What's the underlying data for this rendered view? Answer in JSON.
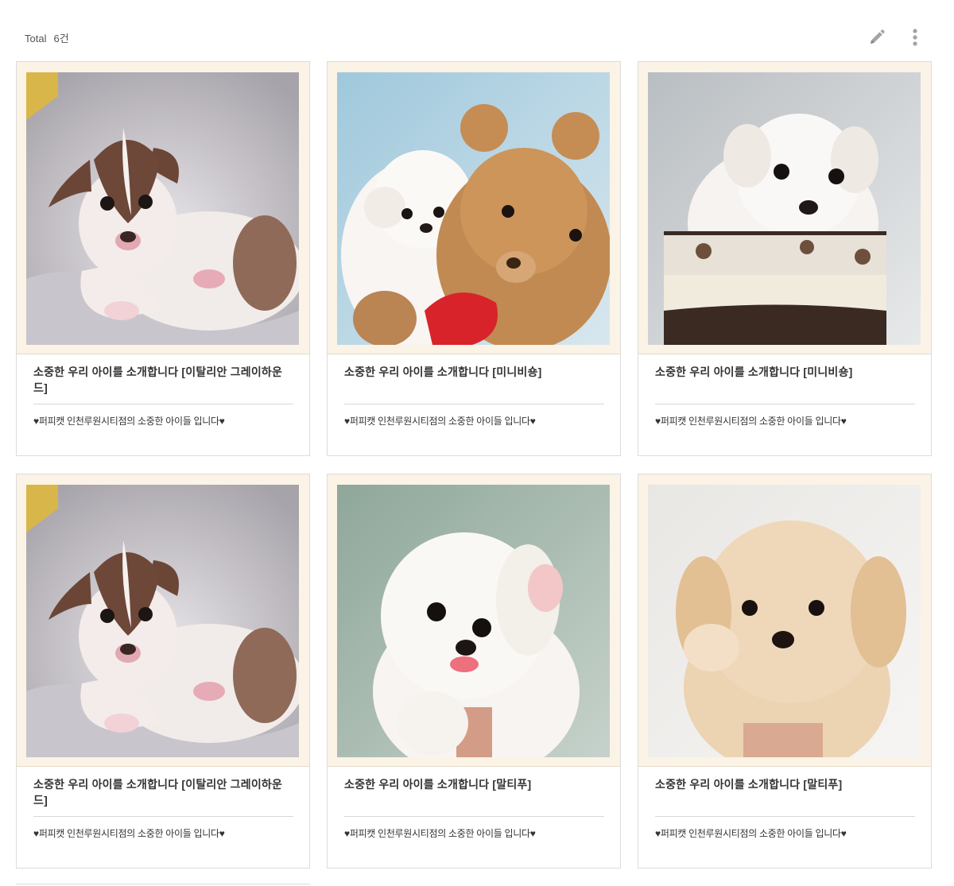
{
  "header": {
    "total_label": "Total",
    "total_count": "6건"
  },
  "toolbar": {
    "write_icon": "pencil-icon",
    "more_icon": "more-vertical-icon"
  },
  "cards": [
    {
      "title": "소중한 우리 아이를 소개합니다 [이탈리안 그레이하운드]",
      "desc": "♥퍼피캣 인천루원시티점의 소중한 아이들 입니다♥",
      "photo": "italian-greyhound-puppy"
    },
    {
      "title": "소중한 우리 아이를 소개합니다 [미니비숑]",
      "desc": "♥퍼피캣 인천루원시티점의 소중한 아이들 입니다♥",
      "photo": "bichon-with-teddy-bear"
    },
    {
      "title": "소중한 우리 아이를 소개합니다 [미니비숑]",
      "desc": "♥퍼피캣 인천루원시티점의 소중한 아이들 입니다♥",
      "photo": "bichon-in-basket"
    },
    {
      "title": "소중한 우리 아이를 소개합니다 [이탈리안 그레이하운드]",
      "desc": "♥퍼피캣 인천루원시티점의 소중한 아이들 입니다♥",
      "photo": "italian-greyhound-puppy"
    },
    {
      "title": "소중한 우리 아이를 소개합니다 [말티푸]",
      "desc": "♥퍼피캣 인천루원시티점의 소중한 아이들 입니다♥",
      "photo": "white-maltipoo-held"
    },
    {
      "title": "소중한 우리 아이를 소개합니다 [말티푸]",
      "desc": "♥퍼피캣 인천루원시티점의 소중한 아이들 입니다♥",
      "photo": "apricot-maltipoo-held"
    }
  ],
  "colors": {
    "frame": "#fbf3e6",
    "border": "#dcdcdc",
    "icon": "#9a9a9a"
  }
}
